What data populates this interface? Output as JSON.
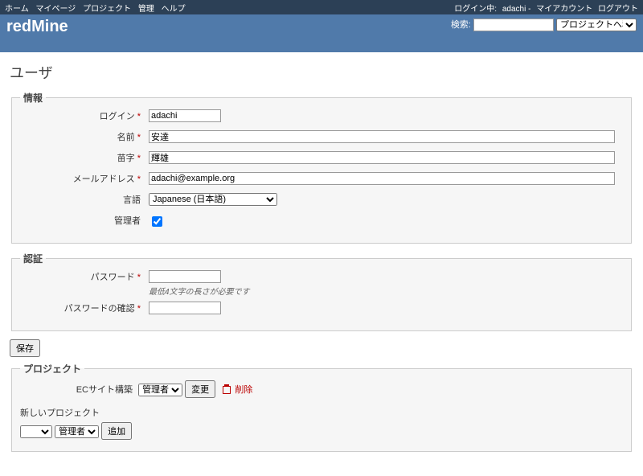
{
  "top_menu": {
    "home": "ホーム",
    "mypage": "マイページ",
    "projects": "プロジェクト",
    "admin": "管理",
    "help": "ヘルプ",
    "logged_as_label": "ログイン中:",
    "logged_user": "adachi",
    "my_account": "マイアカウント",
    "logout": "ログアウト"
  },
  "header": {
    "app_title": "redMine",
    "search_label": "検索:",
    "project_jump": "プロジェクトへ移動..."
  },
  "page": {
    "title": "ユーザ"
  },
  "info_box": {
    "legend": "情報",
    "login_label": "ログイン",
    "login_value": "adachi",
    "firstname_label": "名前",
    "firstname_value": "安達",
    "lastname_label": "苗字",
    "lastname_value": "輝雄",
    "mail_label": "メールアドレス",
    "mail_value": "adachi@example.org",
    "language_label": "言語",
    "language_value": "Japanese (日本語)",
    "admin_label": "管理者"
  },
  "auth_box": {
    "legend": "認証",
    "password_label": "パスワード",
    "password_hint": "最低4文字の長さが必要です",
    "password_confirm_label": "パスワードの確認"
  },
  "buttons": {
    "save": "保存",
    "change": "変更",
    "delete": "削除",
    "add": "追加"
  },
  "projects_box": {
    "legend": "プロジェクト",
    "project_name": "ECサイト構築",
    "role_selected": "管理者"
  },
  "new_project": {
    "label": "新しいプロジェクト",
    "role_selected": "管理者"
  }
}
